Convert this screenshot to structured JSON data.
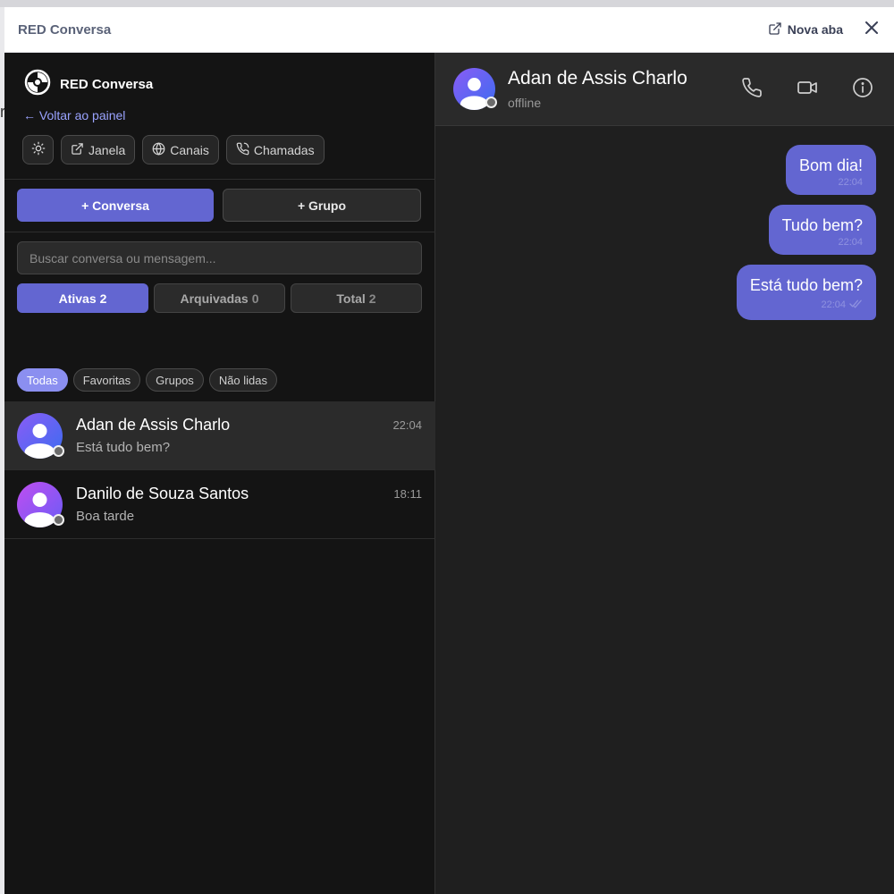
{
  "window": {
    "title": "RED Conversa",
    "new_tab_label": "Nova aba"
  },
  "background_fragment": "r",
  "sidebar": {
    "brand": "RED Conversa",
    "back_link": "← Voltar ao painel",
    "toolbar": {
      "window_label": "Janela",
      "channels_label": "Canais",
      "calls_label": "Chamadas"
    },
    "new_conversation_label": "+ Conversa",
    "new_group_label": "+ Grupo",
    "search": {
      "placeholder": "Buscar conversa ou mensagem...",
      "value": ""
    },
    "segments": [
      {
        "label": "Ativas",
        "count": "2",
        "active": true
      },
      {
        "label": "Arquivadas",
        "count": "0",
        "active": false
      },
      {
        "label": "Total",
        "count": "2",
        "active": false
      }
    ],
    "filters": [
      "Todas",
      "Favoritas",
      "Grupos",
      "Não lidas"
    ],
    "active_filter": "Todas",
    "conversations": [
      {
        "name": "Adan de Assis Charlo",
        "time": "22:04",
        "preview": "Está tudo bem?",
        "selected": true,
        "status": "offline"
      },
      {
        "name": "Danilo de Souza Santos",
        "time": "18:11",
        "preview": "Boa tarde",
        "selected": false,
        "status": "offline"
      }
    ]
  },
  "chat": {
    "contact_name": "Adan de Assis Charlo",
    "contact_status": "offline",
    "header_icons": [
      "phone-icon",
      "video-camera-icon",
      "info-icon"
    ],
    "messages": [
      {
        "text": "Bom dia!",
        "time": "22:04",
        "read_receipt": false
      },
      {
        "text": "Tudo bem?",
        "time": "22:04",
        "read_receipt": false
      },
      {
        "text": "Está tudo bem?",
        "time": "22:04",
        "read_receipt": true
      }
    ]
  },
  "colors": {
    "accent": "#6366d1",
    "accent_light": "#8b8ff0",
    "sidebar_bg": "#141414",
    "chat_bg": "#1f1f1f",
    "header_bg": "#2a2a2a",
    "link": "#9aa3ff"
  }
}
